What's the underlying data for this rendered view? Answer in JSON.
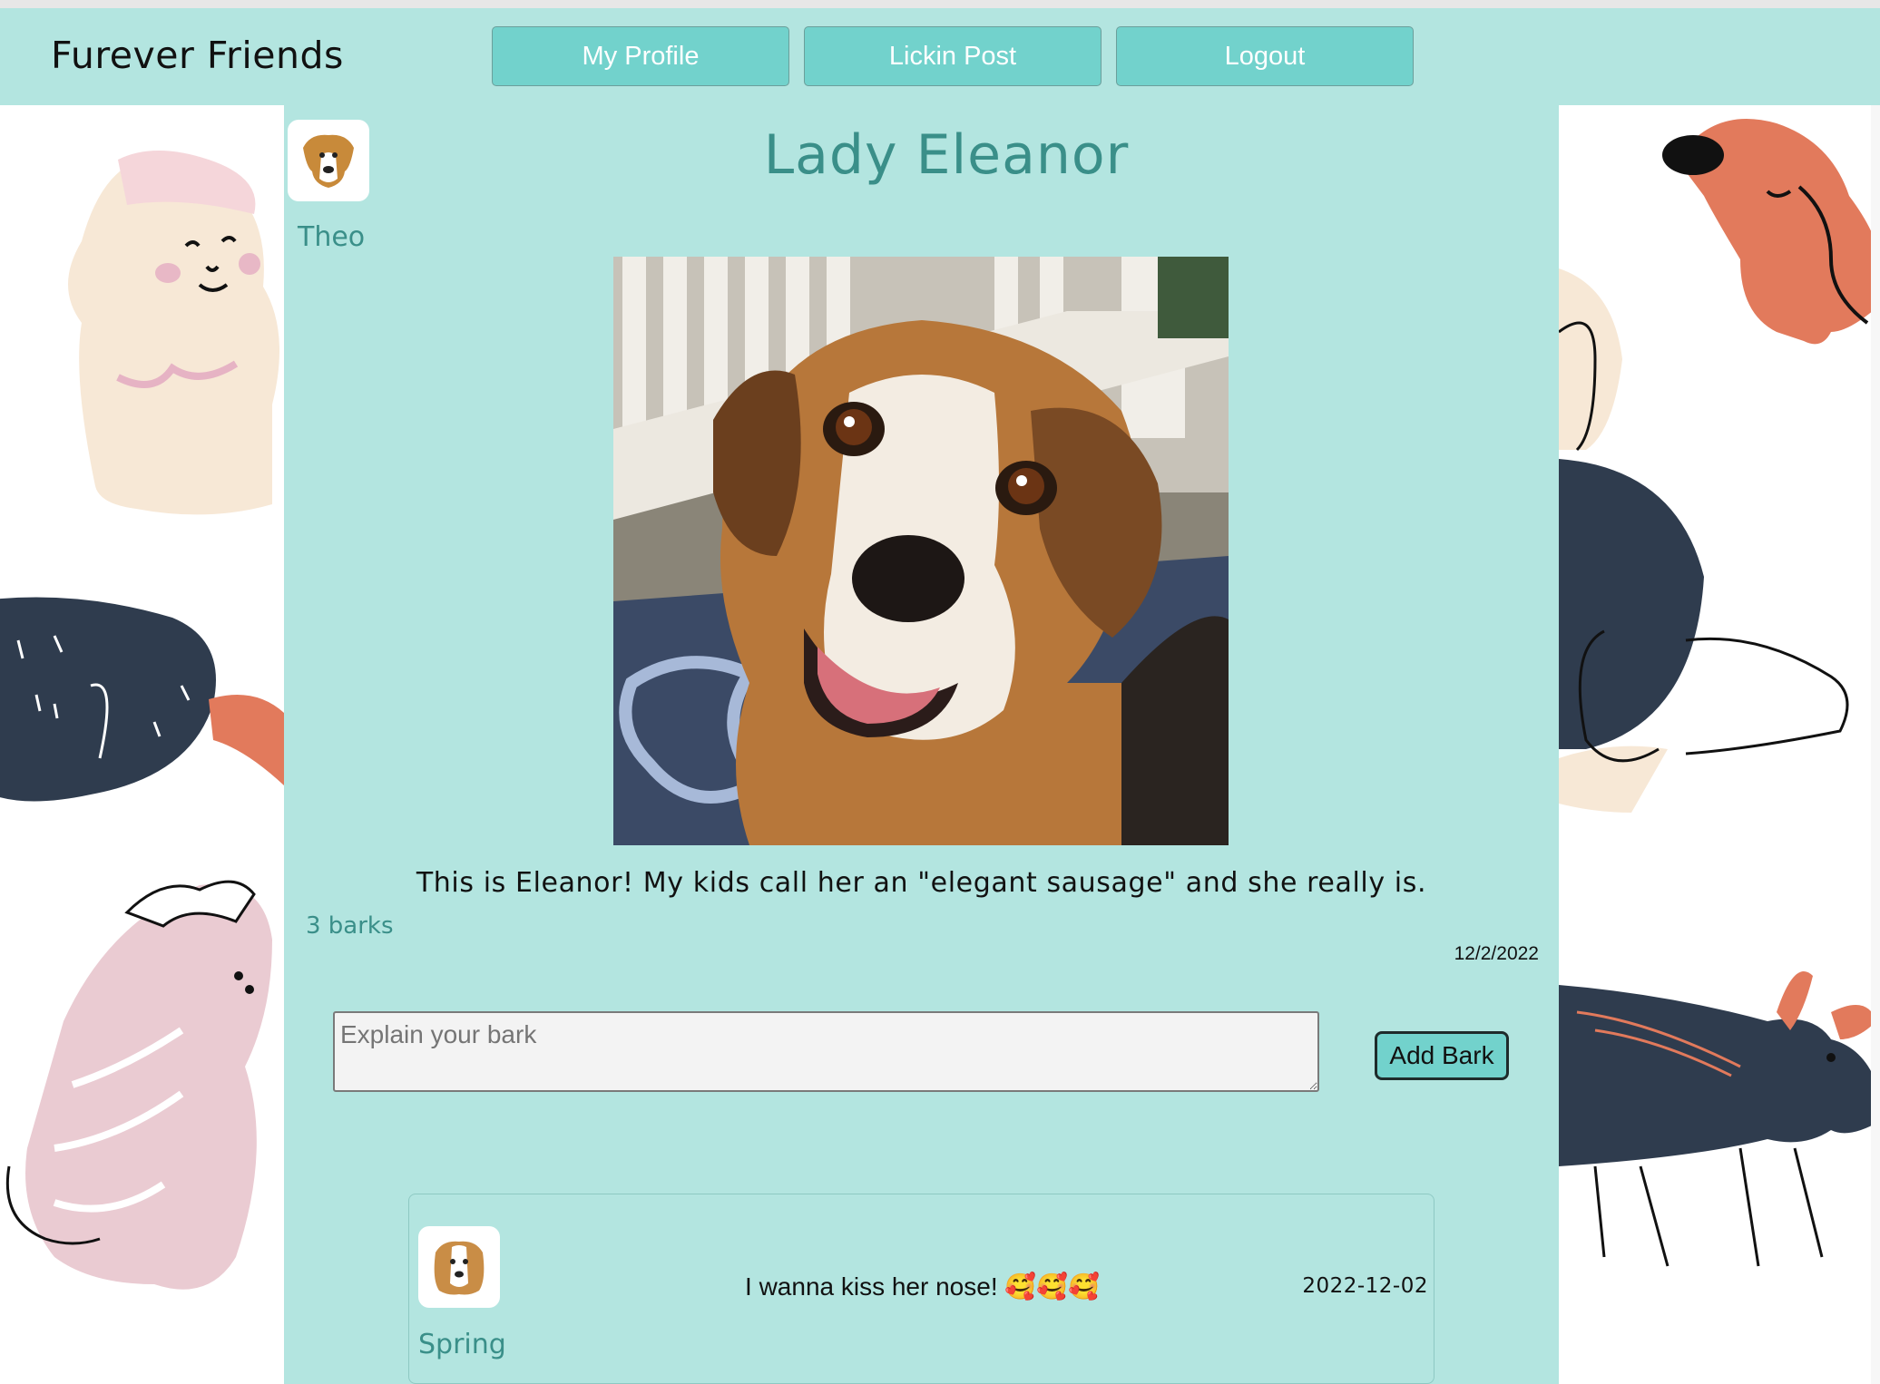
{
  "header": {
    "brand": "Furever Friends",
    "nav": [
      "My Profile",
      "Lickin Post",
      "Logout"
    ]
  },
  "post": {
    "author": "Theo",
    "title": "Lady Eleanor",
    "caption": "This is Eleanor! My kids call her an \"elegant sausage\" and she really is.",
    "barks_count": "3 barks",
    "date": "12/2/2022",
    "photo_icon": "beagle-photo"
  },
  "bark_form": {
    "placeholder": "Explain your bark",
    "submit_label": "Add Bark"
  },
  "comments": [
    {
      "author": "Spring",
      "text": "I wanna kiss her nose! 🥰🥰🥰",
      "date": "2022-12-02"
    }
  ],
  "colors": {
    "header_bg": "#b3e5e0",
    "button_bg": "#72d2cc",
    "accent_text": "#3a8f89"
  }
}
